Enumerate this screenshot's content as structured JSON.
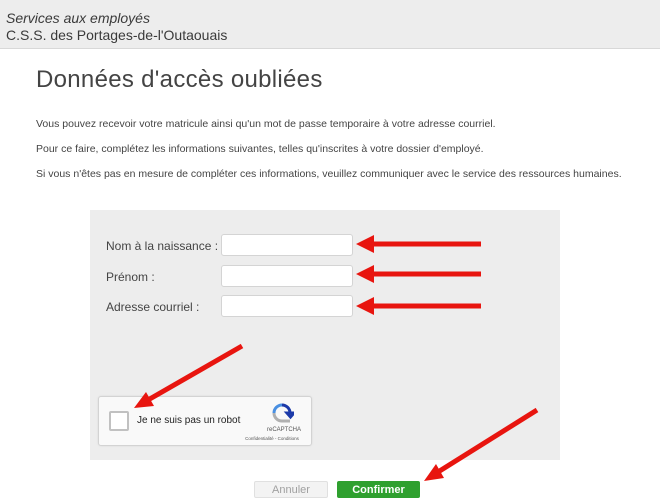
{
  "header": {
    "line1": "Services aux employés",
    "line2": "C.S.S. des Portages-de-l'Outaouais"
  },
  "page_title": "Données d'accès oubliées",
  "paragraphs": [
    "Vous pouvez recevoir votre matricule ainsi qu'un mot de passe temporaire à votre adresse courriel.",
    "Pour ce faire, complétez les informations suivantes, telles qu'inscrites à votre dossier d'employé.",
    "Si vous n'êtes pas en mesure de compléter ces informations, veuillez communiquer avec le service des ressources humaines."
  ],
  "form": {
    "birth_name_label": "Nom à la naissance :",
    "first_name_label": "Prénom :",
    "email_label": "Adresse courriel :",
    "birth_name_value": "",
    "first_name_value": "",
    "email_value": ""
  },
  "captcha": {
    "checkbox_label": "Je ne suis pas un robot",
    "brand": "reCAPTCHA",
    "links": "Confidentialité - Conditions"
  },
  "buttons": {
    "cancel": "Annuler",
    "confirm": "Confirmer"
  },
  "colors": {
    "arrow": "#e8150f",
    "confirm": "#2fa02f",
    "panel": "#ededed"
  }
}
